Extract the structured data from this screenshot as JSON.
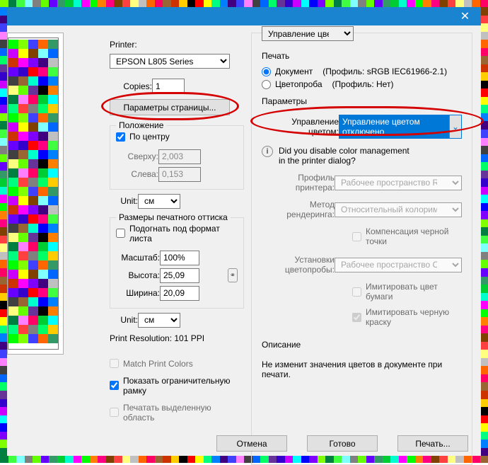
{
  "titlebar": {
    "close": "✕"
  },
  "left": {
    "printer_label": "Printer:",
    "printer_value": "EPSON L805 Series",
    "copies_label": "Copies:",
    "copies_value": "1",
    "page_setup_btn": "Параметры страницы...",
    "position": {
      "title": "Положение",
      "center": "По центру",
      "top_label": "Сверху:",
      "top_value": "2,003",
      "left_label": "Слева:",
      "left_value": "0,153"
    },
    "unit_label": "Unit:",
    "unit_value": "см",
    "size": {
      "title": "Размеры печатного оттиска",
      "fit": "Подогнать под формат листа",
      "scale_label": "Масштаб:",
      "scale_value": "100%",
      "height_label": "Высота:",
      "height_value": "25,09",
      "width_label": "Ширина:",
      "width_value": "20,09"
    },
    "resolution": "Print Resolution: 101 PPI",
    "match_colors": "Match Print Colors",
    "show_bbox": "Показать ограничительную рамку",
    "print_selection": "Печатать выделенную область"
  },
  "right": {
    "cm_dropdown": "Управление цветом",
    "print_label": "Печать",
    "doc_label": "Документ",
    "doc_profile": "(Профиль: sRGB IEC61966-2.1)",
    "proof_label": "Цветопроба",
    "proof_profile": "(Профиль: Нет)",
    "params_label": "Параметры",
    "cm_label": "Управление цветом:",
    "cm_value": "Управление цветом отключено",
    "hint1": "Did you disable color management",
    "hint2": "in the printer dialog?",
    "printer_profile_label": "Профиль принтера:",
    "printer_profile_value": "Рабочее пространство RGB - ...",
    "render_label": "Метод рендеринга:",
    "render_value": "Относительный колориметр...",
    "bpc": "Компенсация черной точки",
    "proof_setup_label": "Установки цветопробы:",
    "proof_setup_value": "Рабочее пространство CMYK ...",
    "sim_paper": "Имитировать цвет бумаги",
    "sim_black": "Имитировать черную краску",
    "desc_label": "Описание",
    "desc_text": "Не изменит значения цветов в документе при печати."
  },
  "buttons": {
    "cancel": "Отмена",
    "done": "Готово",
    "print": "Печать..."
  },
  "palette": [
    "#ff00ff",
    "#00ffff",
    "#ff0000",
    "#00ff00",
    "#0000ff",
    "#ffff00",
    "#ff8000",
    "#8000ff",
    "#00ff80",
    "#ff0080",
    "#80ff00",
    "#0080ff",
    "#804000",
    "#008040",
    "#400080",
    "#ff4040",
    "#40ff40",
    "#4040ff",
    "#ffff80",
    "#80ffff",
    "#ff80ff",
    "#c0c0c0",
    "#808080",
    "#404040",
    "#ff6600",
    "#66ff00",
    "#0066ff",
    "#ff0066",
    "#6600ff",
    "#00ff66",
    "#996633",
    "#339966",
    "#663399",
    "#cc3300",
    "#00cc33",
    "#3300cc",
    "#ffcc00",
    "#00ffcc",
    "#cc00ff",
    "#000000"
  ]
}
